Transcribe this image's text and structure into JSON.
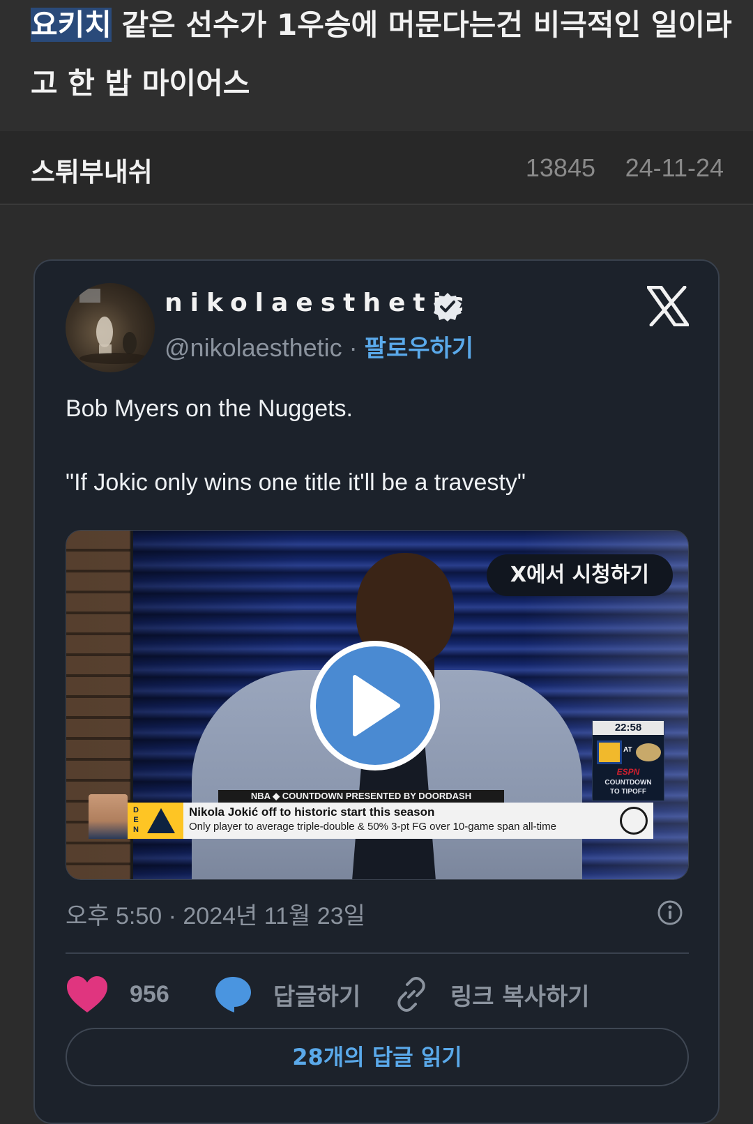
{
  "post": {
    "title_highlight": "요키치",
    "title_rest": " 같은 선수가 1우승에 머문다는건 비극적인 일이라고 한 밥 마이어스",
    "author": "스튀부내쉬",
    "views": "13845",
    "date": "24-11-24"
  },
  "tweet": {
    "display_name": "nikolaesthetic",
    "handle": "@nikolaesthetic",
    "separator": " · ",
    "follow_label": "팔로우하기",
    "text_lines": [
      "Bob Myers on the Nuggets.",
      "\"If Jokic only wins one title it'll be a travesty\""
    ],
    "timestamp": "오후 5:50 · 2024년 11월 23일",
    "actions": {
      "like_count": "956",
      "reply_label": "답글하기",
      "copy_link_label": "링크 복사하기"
    },
    "read_replies_label": "28개의 답글 읽기"
  },
  "video": {
    "watch_on_x_label": "X에서 시청하기",
    "scoreboard_time": "22:58",
    "scoreboard_at": "AT",
    "network": "ESPN",
    "countdown_line1": "COUNTDOWN",
    "countdown_line2": "TO TIPOFF",
    "show_bar": "NBA ◆ COUNTDOWN PRESENTED BY DOORDASH",
    "team_abbr": "D E N",
    "headline": "Nikola Jokić off to historic start this season",
    "subline": "Only player to average triple-double & 50% 3-pt FG over 10-game span all-time"
  },
  "colors": {
    "page_bg": "#2c2c2c",
    "card_bg": "#1c222b",
    "link_blue": "#5aa9ea",
    "like_pink": "#e0357f",
    "reply_blue": "#4a95e0",
    "play_blue": "#4a8ad2"
  },
  "icons": [
    "verified-badge-icon",
    "x-logo-icon",
    "play-icon",
    "info-icon",
    "heart-icon",
    "reply-bubble-icon",
    "link-icon"
  ]
}
